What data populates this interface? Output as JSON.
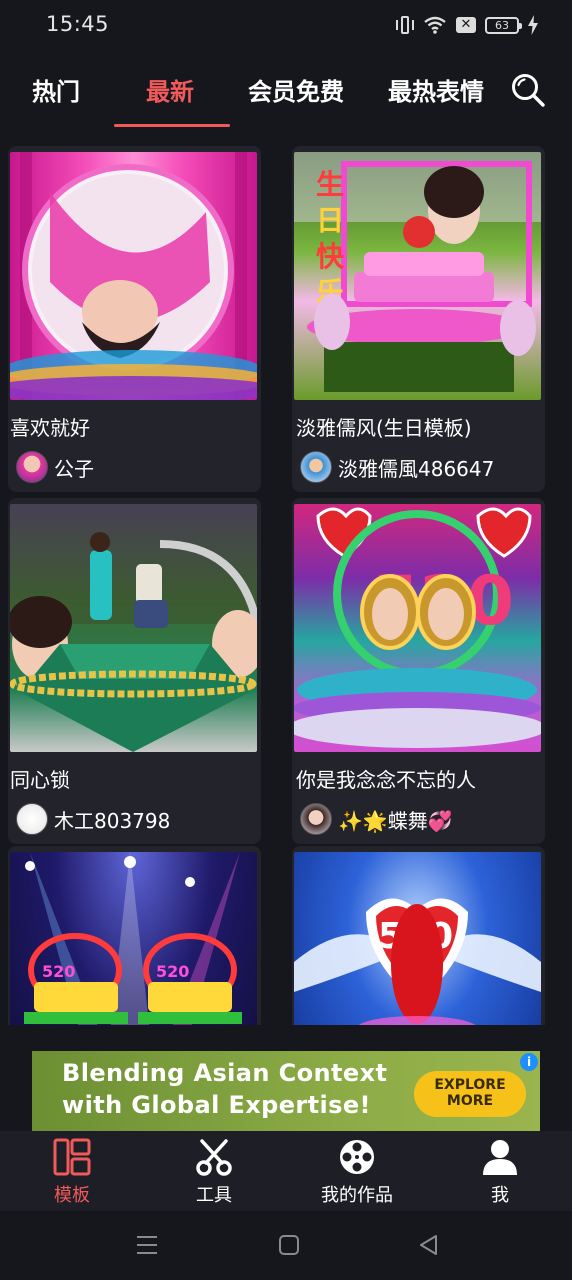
{
  "status_bar": {
    "time": "15:45",
    "battery": "63",
    "icons": [
      "vibrate-icon",
      "wifi-icon",
      "sim-off-icon",
      "battery-icon",
      "charging-icon"
    ]
  },
  "tabs": [
    {
      "label": "热门",
      "active": false
    },
    {
      "label": "最新",
      "active": true
    },
    {
      "label": "会员免费",
      "active": false
    },
    {
      "label": "最热表情",
      "active": false
    }
  ],
  "search_icon": "search-icon",
  "cards": [
    {
      "title": "喜欢就好",
      "author": "公子",
      "thumb_text": ""
    },
    {
      "title": "淡雅儒风(生日模板)",
      "author": "淡雅儒風486647",
      "thumb_text": "生日快乐"
    },
    {
      "title": "同心锁",
      "author": "木工803798",
      "thumb_text": ""
    },
    {
      "title": "你是我念念不忘的人",
      "author": "✨🌟蝶舞💞",
      "thumb_text": "520"
    },
    {
      "title": "",
      "author": "",
      "thumb_text": "520"
    },
    {
      "title": "",
      "author": "",
      "thumb_text": "520"
    }
  ],
  "ad": {
    "line1": "Blending Asian Context",
    "line2": "with Global Expertise!",
    "cta": "EXPLORE MORE",
    "info": "i",
    "close": "✕"
  },
  "bottom_nav": [
    {
      "label": "模板",
      "icon": "template-grid-icon",
      "active": true
    },
    {
      "label": "工具",
      "icon": "scissors-icon",
      "active": false
    },
    {
      "label": "我的作品",
      "icon": "film-reel-icon",
      "active": false
    },
    {
      "label": "我",
      "icon": "person-icon",
      "active": false
    }
  ],
  "colors": {
    "accent": "#f05a5a",
    "background": "#16171c",
    "card": "#22232b"
  }
}
